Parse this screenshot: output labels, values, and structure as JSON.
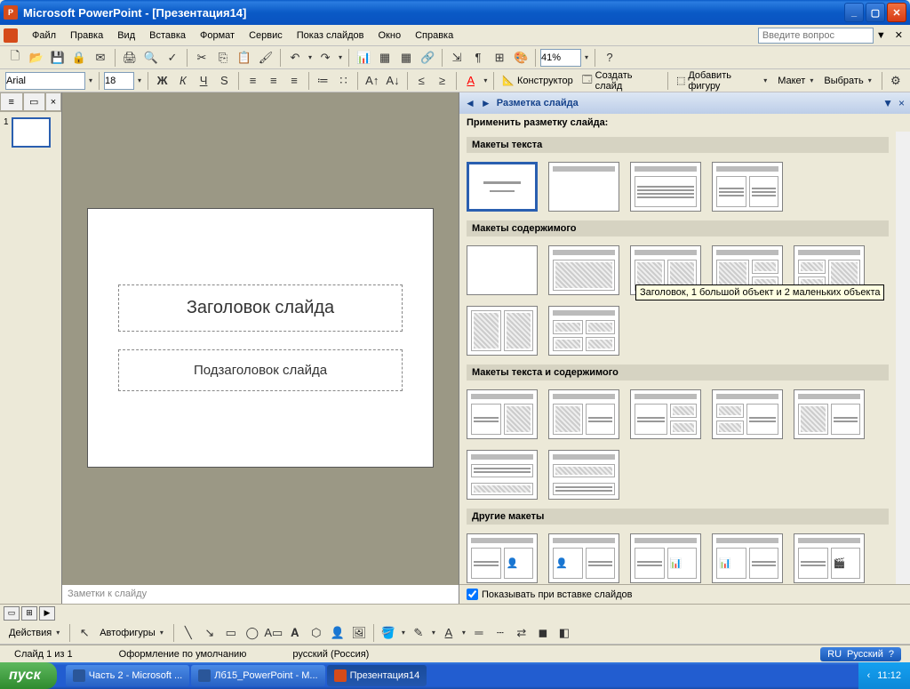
{
  "titlebar": {
    "app": "Microsoft PowerPoint",
    "doc": "[Презентация14]"
  },
  "menubar": {
    "items": [
      "Файл",
      "Правка",
      "Вид",
      "Вставка",
      "Формат",
      "Сервис",
      "Показ слайдов",
      "Окно",
      "Справка"
    ],
    "help_placeholder": "Введите вопрос"
  },
  "toolbar2": {
    "font": "Arial",
    "size": "18",
    "design_label": "Конструктор",
    "newslide_label": "Создать слайд",
    "addshape_label": "Добавить фигуру",
    "layout_label": "Макет",
    "select_label": "Выбрать"
  },
  "zoom": "41%",
  "outline": {
    "slide_number": "1"
  },
  "slide": {
    "title": "Заголовок слайда",
    "subtitle": "Подзаголовок слайда"
  },
  "notes_placeholder": "Заметки к слайду",
  "taskpane": {
    "title": "Разметка слайда",
    "apply_label": "Применить разметку слайда:",
    "sections": {
      "text": "Макеты текста",
      "content": "Макеты содержимого",
      "text_content": "Макеты текста и содержимого",
      "other": "Другие макеты"
    },
    "tooltip": "Заголовок, 1 большой объект и 2 маленьких объекта",
    "show_checkbox": "Показывать при вставке слайдов"
  },
  "drawbar": {
    "actions": "Действия",
    "autoshapes": "Автофигуры"
  },
  "status": {
    "slide": "Слайд 1 из 1",
    "design": "Оформление по умолчанию",
    "lang": "русский (Россия)",
    "badge_code": "RU",
    "badge_lang": "Русский"
  },
  "taskbar": {
    "start": "пуск",
    "tasks": [
      "Часть 2 - Microsoft ...",
      "Лб15_PowerPoint - M...",
      "Презентация14"
    ],
    "clock": "11:12"
  }
}
